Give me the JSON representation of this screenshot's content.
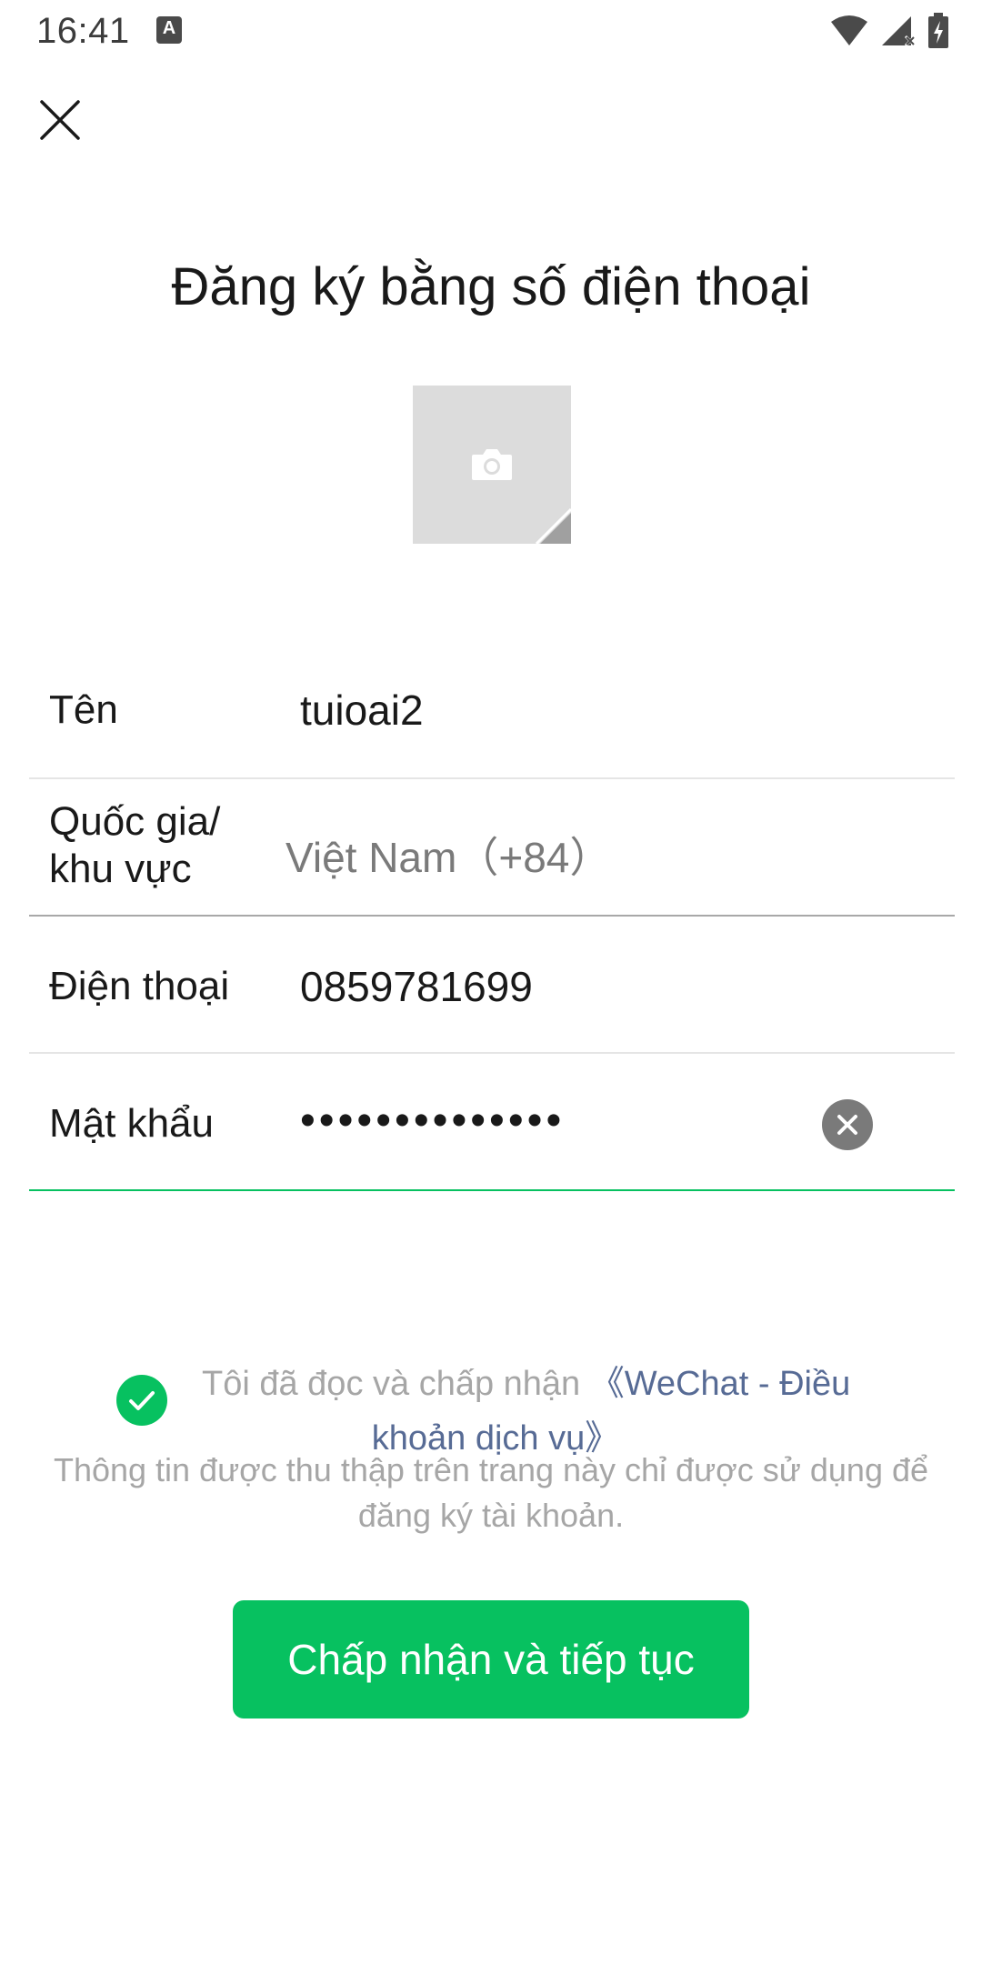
{
  "status_bar": {
    "time": "16:41",
    "notification_letter": "A"
  },
  "header": {
    "title": "Đăng ký bằng số điện thoại"
  },
  "form": {
    "name": {
      "label": "Tên",
      "value": "tuioai2"
    },
    "region": {
      "label_line1": "Quốc gia/",
      "label_line2": "khu vực",
      "value": "Việt Nam（+84）"
    },
    "phone": {
      "label": "Điện thoại",
      "value": "0859781699"
    },
    "password": {
      "label": "Mật khẩu",
      "value": "••••••••••••••"
    }
  },
  "agreement": {
    "text": "Tôi đã đọc và chấp nhận",
    "link_part1": "《WeChat - Điều",
    "link_part2": "khoản dịch vụ》",
    "checked": true
  },
  "notice": "Thông tin được thu thập trên trang này chỉ được sử dụng để đăng ký tài khoản.",
  "primary_button": "Chấp nhận và tiếp tục",
  "colors": {
    "accent": "#07c160",
    "link": "#576b95",
    "muted_text": "#a6a6a6"
  }
}
